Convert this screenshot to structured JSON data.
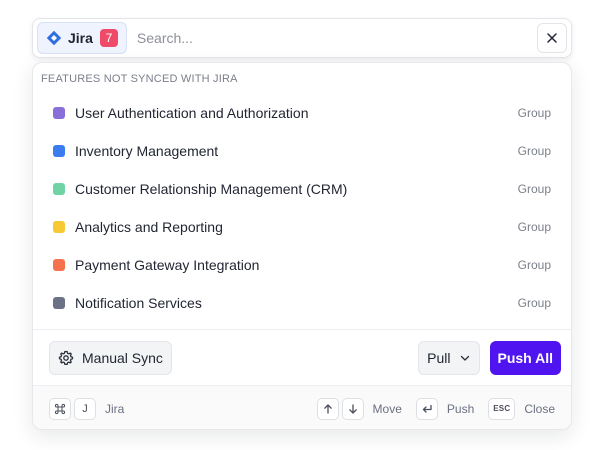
{
  "search": {
    "source_label": "Jira",
    "unsynced_count": "7",
    "placeholder": "Search...",
    "value": ""
  },
  "panel": {
    "section_title": "FEATURES NOT SYNCED WITH JIRA",
    "items": [
      {
        "name": "User Authentication and Authorization",
        "type": "Group",
        "color": "#8b6fd8"
      },
      {
        "name": "Inventory Management",
        "type": "Group",
        "color": "#3b7bf0"
      },
      {
        "name": "Customer Relationship Management (CRM)",
        "type": "Group",
        "color": "#6fd3a6"
      },
      {
        "name": "Analytics and Reporting",
        "type": "Group",
        "color": "#f7c935"
      },
      {
        "name": "Payment Gateway Integration",
        "type": "Group",
        "color": "#f4734e"
      },
      {
        "name": "Notification Services",
        "type": "Group",
        "color": "#6b7285"
      }
    ]
  },
  "actions": {
    "manual_sync_label": "Manual Sync",
    "pull_label": "Pull",
    "push_all_label": "Push All"
  },
  "footer": {
    "jira_key": "J",
    "jira_label": "Jira",
    "move_label": "Move",
    "push_label": "Push",
    "esc_key": "ESC",
    "close_label": "Close"
  },
  "colors": {
    "accent": "#4f14f0",
    "badge": "#ef4b68",
    "jira_blue": "#2f6fe0"
  },
  "icons": {
    "source": "jira-logo-icon",
    "close": "close-icon",
    "settings": "gear-icon",
    "dropdown": "chevron-down-icon",
    "command": "command-key-icon",
    "up": "arrow-up-icon",
    "down": "arrow-down-icon",
    "enter": "enter-key-icon"
  }
}
